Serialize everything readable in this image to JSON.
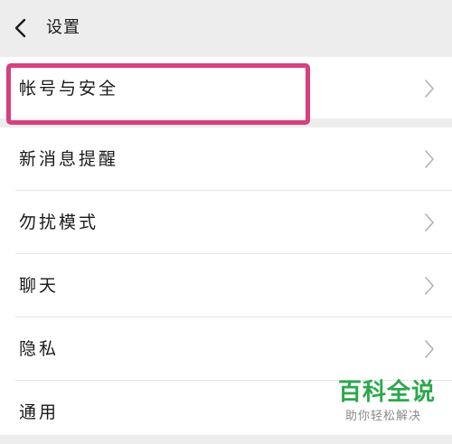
{
  "header": {
    "title": "设置",
    "back_icon": "back-arrow-icon"
  },
  "settings": {
    "items": [
      {
        "label": "帐号与安全",
        "icon": "chevron-right-icon",
        "highlighted": true
      },
      {
        "label": "新消息提醒",
        "icon": "chevron-right-icon"
      },
      {
        "label": "勿扰模式",
        "icon": "chevron-right-icon"
      },
      {
        "label": "聊天",
        "icon": "chevron-right-icon"
      },
      {
        "label": "隐私",
        "icon": "chevron-right-icon"
      },
      {
        "label": "通用"
      }
    ]
  },
  "watermark": {
    "title": "百科全说",
    "subtitle": "助你轻松解决"
  },
  "colors": {
    "background": "#ededed",
    "highlight": "#d6407f",
    "watermark": "#2ca84c"
  }
}
